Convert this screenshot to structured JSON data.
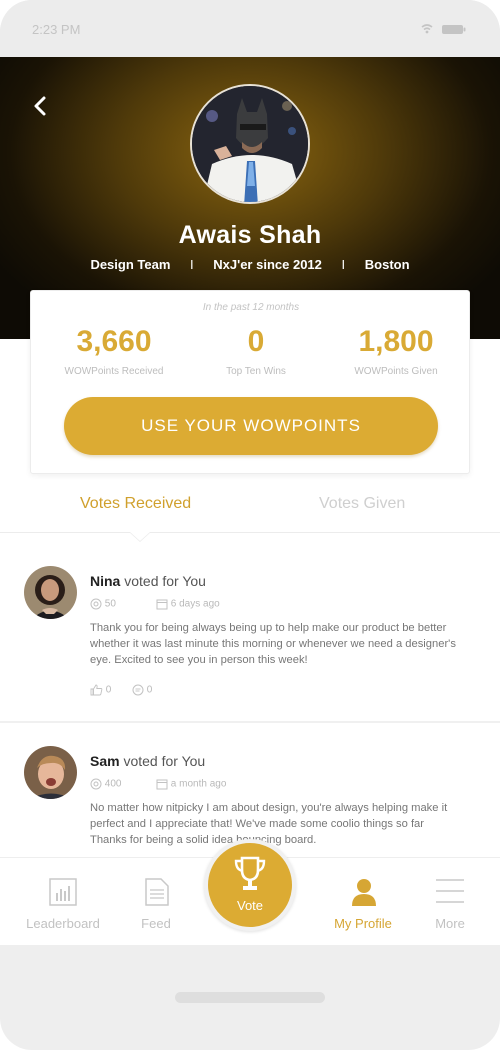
{
  "status_bar": {
    "time": "2:23 PM"
  },
  "profile": {
    "name": "Awais Shah",
    "team": "Design Team",
    "tenure": "NxJ'er since 2012",
    "location": "Boston",
    "separator": "I"
  },
  "stats": {
    "period": "In the past 12 months",
    "items": [
      {
        "value": "3,660",
        "label": "WOWPoints Received"
      },
      {
        "value": "0",
        "label": "Top Ten Wins"
      },
      {
        "value": "1,800",
        "label": "WOWPoints Given"
      }
    ],
    "cta_label": "USE YOUR WOWPOINTS"
  },
  "tabs": [
    {
      "label": "Votes Received",
      "active": true
    },
    {
      "label": "Votes Given",
      "active": false
    }
  ],
  "votes": [
    {
      "name": "Nina",
      "action": " voted for You",
      "points": "50",
      "time": "6 days ago",
      "text": "Thank you for being always being up to help make our product be better whether it was last minute this morning or whenever we need a designer's eye. Excited to see you in person this week!",
      "likes": "0",
      "comments": "0"
    },
    {
      "name": "Sam",
      "action": " voted for You",
      "points": "400",
      "time": "a month ago",
      "text": "No matter how nitpicky I am about design, you're always helping make it perfect and I appreciate that! We've made some coolio things so far Thanks for being a solid idea bouncing board."
    }
  ],
  "nav": {
    "items": [
      {
        "label": "Leaderboard",
        "icon": "bar-chart-icon"
      },
      {
        "label": "Feed",
        "icon": "document-icon"
      },
      {
        "label": "Vote",
        "icon": "trophy-icon"
      },
      {
        "label": "My Profile",
        "icon": "person-icon",
        "active": true
      },
      {
        "label": "More",
        "icon": "menu-icon"
      }
    ]
  },
  "colors": {
    "accent": "#dcab33",
    "hero_dark": "#0e0b05",
    "hero_glow": "#8a6510",
    "muted_text": "#c2c2c2"
  }
}
